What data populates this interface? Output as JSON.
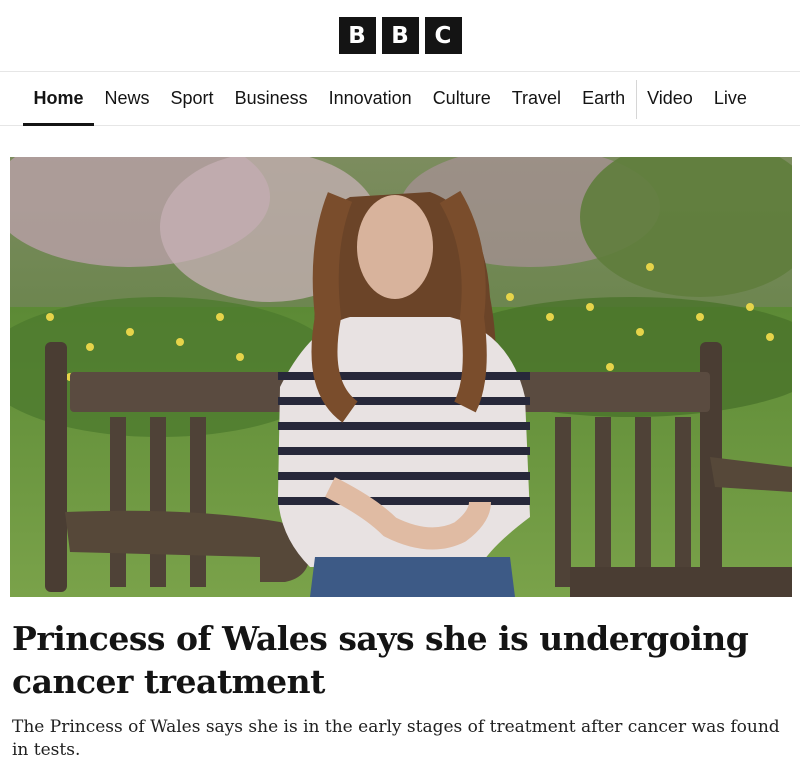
{
  "brand": {
    "letters": [
      "B",
      "B",
      "C"
    ]
  },
  "nav": {
    "items": [
      {
        "label": "Home",
        "active": true
      },
      {
        "label": "News",
        "active": false
      },
      {
        "label": "Sport",
        "active": false
      },
      {
        "label": "Business",
        "active": false
      },
      {
        "label": "Innovation",
        "active": false
      },
      {
        "label": "Culture",
        "active": false
      },
      {
        "label": "Travel",
        "active": false
      },
      {
        "label": "Earth",
        "active": false
      },
      {
        "label": "Video",
        "active": false
      },
      {
        "label": "Live",
        "active": false
      }
    ]
  },
  "article": {
    "headline": "Princess of Wales says she is undergoing cancer treatment",
    "summary": "The Princess of Wales says she is in the early stages of treatment after cancer was found in tests."
  },
  "colors": {
    "logo_bg": "#141414",
    "text": "#141414",
    "divider": "#e6e6e6"
  }
}
